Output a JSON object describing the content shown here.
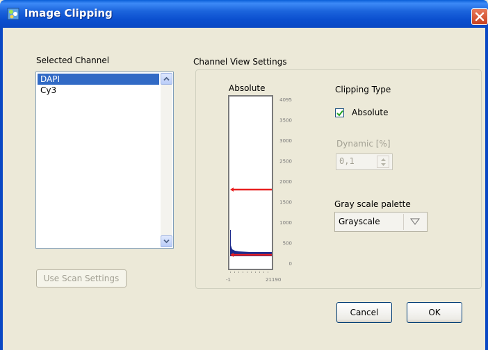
{
  "window": {
    "title": "Image Clipping"
  },
  "channels": {
    "label": "Selected Channel",
    "items": [
      "DAPI",
      "Cy3"
    ],
    "selected": "DAPI"
  },
  "use_scan_settings_label": "Use Scan Settings",
  "view_settings": {
    "label": "Channel View Settings",
    "histogram": {
      "title": "Absolute",
      "y_ticks": [
        "4095",
        "3500",
        "3000",
        "2500",
        "2000",
        "1500",
        "1000",
        "500",
        "0"
      ],
      "x_min_label": "-1",
      "x_max_label": "21190",
      "upper_clip_value": 1800,
      "lower_clip_value": 0
    },
    "clipping_type": {
      "label": "Clipping Type",
      "absolute_label": "Absolute",
      "absolute_checked": true
    },
    "dynamic": {
      "label": "Dynamic [%]",
      "value": "0,1"
    },
    "palette": {
      "label": "Gray scale palette",
      "value": "Grayscale"
    }
  },
  "buttons": {
    "cancel": "Cancel",
    "ok": "OK"
  },
  "colors": {
    "titlebar": "#0a5fd8",
    "selection": "#316ac5",
    "clip_line": "#e82020",
    "histogram": "#1c2a8c"
  }
}
